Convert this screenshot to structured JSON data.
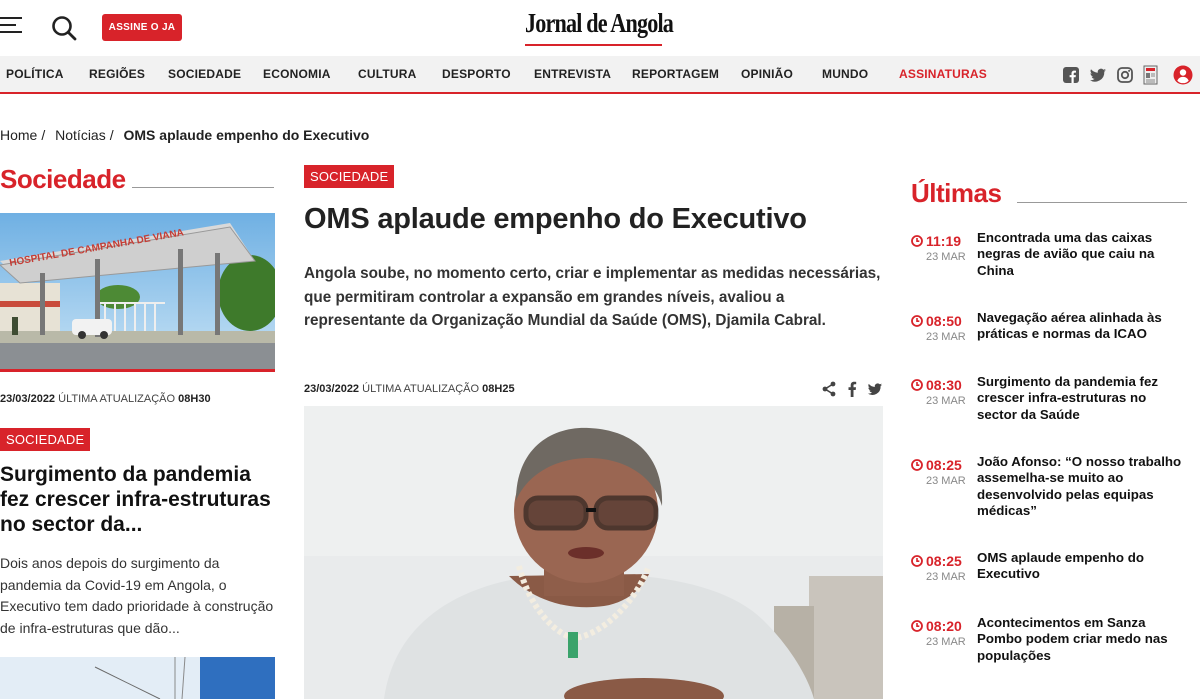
{
  "header": {
    "subscribe_label": "ASSINE O JA",
    "logo_text": "Jornal de Angola"
  },
  "nav": {
    "items": [
      "POLÍTICA",
      "REGIÕES",
      "SOCIEDADE",
      "ECONOMIA",
      "CULTURA",
      "DESPORTO",
      "ENTREVISTA",
      "REPORTAGEM",
      "OPINIÃO",
      "MUNDO",
      "ASSINATURAS"
    ],
    "social_icons": [
      "facebook-icon",
      "twitter-icon",
      "instagram-icon",
      "newspaper-icon",
      "user-icon"
    ]
  },
  "breadcrumb": {
    "home": "Home",
    "section": "Notícias",
    "current": "OMS aplaude empenho do Executivo"
  },
  "left": {
    "section_title": "Sociedade",
    "photo_sign": "HOSPITAL DE CAMPANHA DE VIANA",
    "meta_date": "23/03/2022",
    "meta_label": "ÚLTIMA ATUALIZAÇÃO",
    "meta_time": "08H30",
    "tag": "SOCIEDADE",
    "headline": "Surgimento da pandemia fez crescer infra-estruturas no sector da...",
    "summary": "Dois anos depois do surgimento da pandemia da Covid-19 em Angola, o Executivo tem dado prioridade à construção de infra-estruturas que dão..."
  },
  "article": {
    "tag": "SOCIEDADE",
    "title": "OMS aplaude empenho do Executivo",
    "lead": "Angola soube, no momento certo, criar e implementar as medidas necessárias, que permitiram controlar a expansão em grandes níveis, avaliou a representante da Organização Mundial da Saúde (OMS), Djamila Cabral.",
    "meta_date": "23/03/2022",
    "meta_label": "ÚLTIMA ATUALIZAÇÃO",
    "meta_time": "08H25",
    "share_icons": [
      "share-icon",
      "facebook-icon",
      "twitter-icon"
    ]
  },
  "latest": {
    "section_title": "Últimas",
    "items": [
      {
        "time": "11:19",
        "date": "23 MAR",
        "title": "Encontrada uma das caixas negras de avião que caiu na China"
      },
      {
        "time": "08:50",
        "date": "23 MAR",
        "title": "Navegação aérea alinhada às práticas e normas da ICAO"
      },
      {
        "time": "08:30",
        "date": "23 MAR",
        "title": "Surgimento da pandemia fez crescer infra-estruturas no sector da Saúde"
      },
      {
        "time": "08:25",
        "date": "23 MAR",
        "title": "João Afonso: “O nosso trabalho assemelha-se muito ao desenvolvido pelas equipas médicas”"
      },
      {
        "time": "08:25",
        "date": "23 MAR",
        "title": "OMS aplaude empenho do Executivo"
      },
      {
        "time": "08:20",
        "date": "23 MAR",
        "title": "Acontecimentos em Sanza Pombo podem criar medo nas populações"
      }
    ]
  },
  "colors": {
    "brand_red": "#d8232a"
  }
}
